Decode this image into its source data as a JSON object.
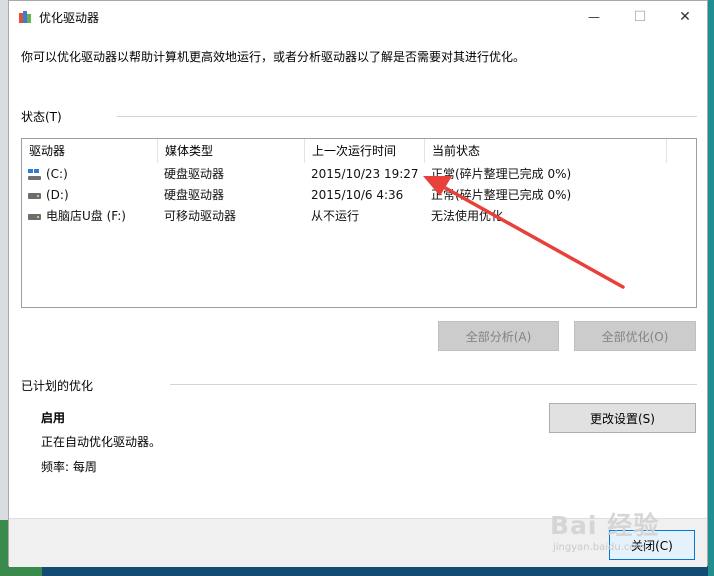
{
  "window": {
    "title": "优化驱动器",
    "minimize_glyph": "—",
    "maximize_glyph": "☐",
    "close_glyph": "✕"
  },
  "intro_text": "你可以优化驱动器以帮助计算机更高效地运行，或者分析驱动器以了解是否需要对其进行优化。",
  "status": {
    "section_label": "状态(T)",
    "columns": [
      "驱动器",
      "媒体类型",
      "上一次运行时间",
      "当前状态"
    ],
    "rows": [
      {
        "drive": "(C:)",
        "media": "硬盘驱动器",
        "last_run": "2015/10/23 19:27",
        "state": "正常(碎片整理已完成 0%)",
        "icon": "windows-drive-icon"
      },
      {
        "drive": "(D:)",
        "media": "硬盘驱动器",
        "last_run": "2015/10/6 4:36",
        "state": "正常(碎片整理已完成 0%)",
        "icon": "hard-drive-icon"
      },
      {
        "drive": "电脑店U盘 (F:)",
        "media": "可移动驱动器",
        "last_run": "从不运行",
        "state": "无法使用优化",
        "icon": "hard-drive-icon"
      }
    ],
    "analyze_all_label": "全部分析(A)",
    "optimize_all_label": "全部优化(O)"
  },
  "scheduled": {
    "section_label": "已计划的优化",
    "state_label": "启用",
    "description": "正在自动优化驱动器。",
    "frequency": "频率: 每周",
    "change_settings_label": "更改设置(S)"
  },
  "footer": {
    "close_label": "关闭(C)"
  },
  "watermark": {
    "main": "Bai 经验",
    "sub": "jingyan.baidu.com"
  },
  "colors": {
    "annotation_arrow": "#e8403a",
    "disabled_button": "#cccccc",
    "window_bg": "#ffffff"
  }
}
